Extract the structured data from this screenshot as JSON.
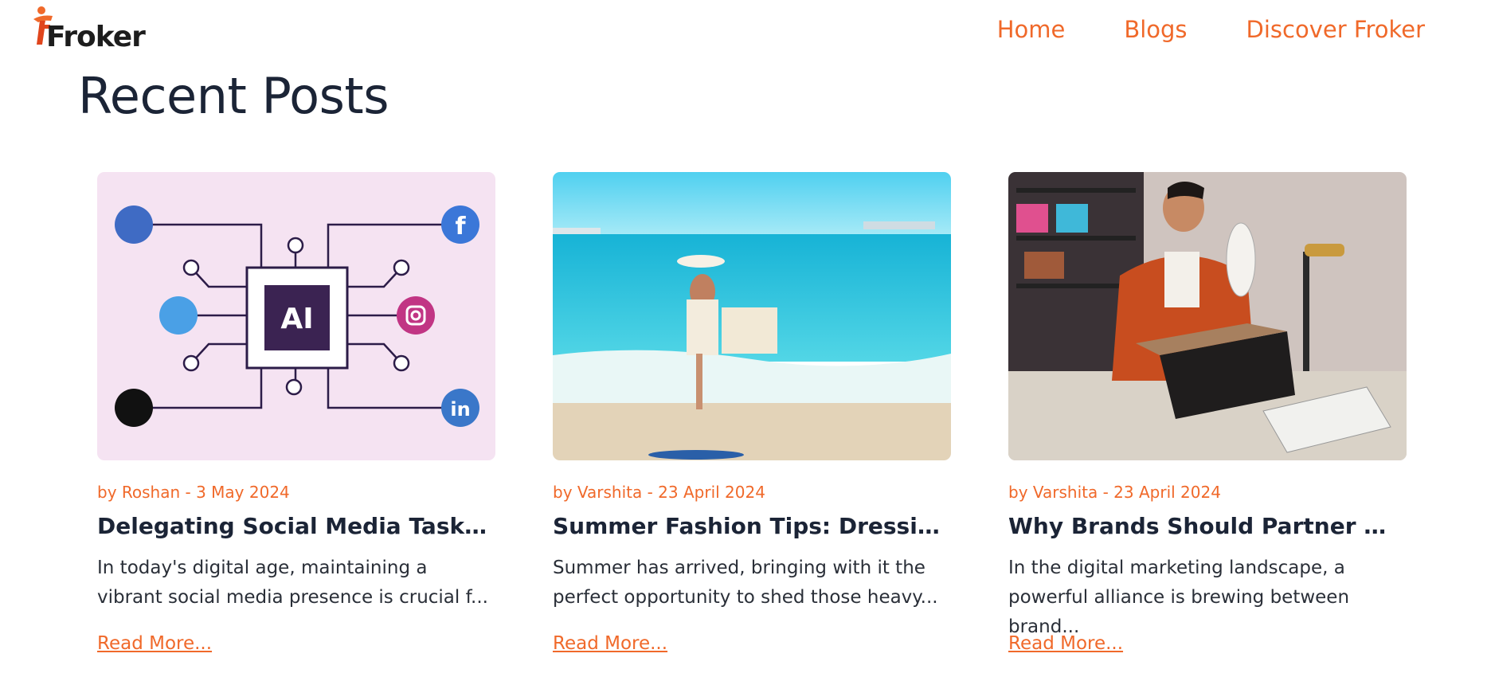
{
  "brand": {
    "logo_text": "Froker",
    "accent_color": "#f0692a"
  },
  "nav": {
    "items": [
      "Home",
      "Blogs",
      "Discover Froker"
    ]
  },
  "section": {
    "title": "Recent Posts"
  },
  "posts": [
    {
      "meta": "by Roshan - 3 May 2024",
      "title": "Delegating Social Media Tasks ...",
      "excerpt": "In today's digital age, maintaining a vibrant social media presence is crucial f...",
      "read_more": "Read More...",
      "image": "ai-social-media-illustration",
      "image_text": "AI"
    },
    {
      "meta": "by Varshita - 23 April 2024",
      "title": "Summer Fashion Tips: Dressing ...",
      "excerpt": "Summer has arrived, bringing with it the perfect opportunity to shed those heavy...",
      "read_more": "Read More...",
      "image": "beach-summer-photo"
    },
    {
      "meta": "by Varshita - 23 April 2024",
      "title": "Why Brands Should Partner with...",
      "excerpt": "In the digital marketing landscape, a powerful alliance is brewing between brand...",
      "read_more": "Read More...",
      "image": "influencer-unboxing-photo"
    }
  ]
}
